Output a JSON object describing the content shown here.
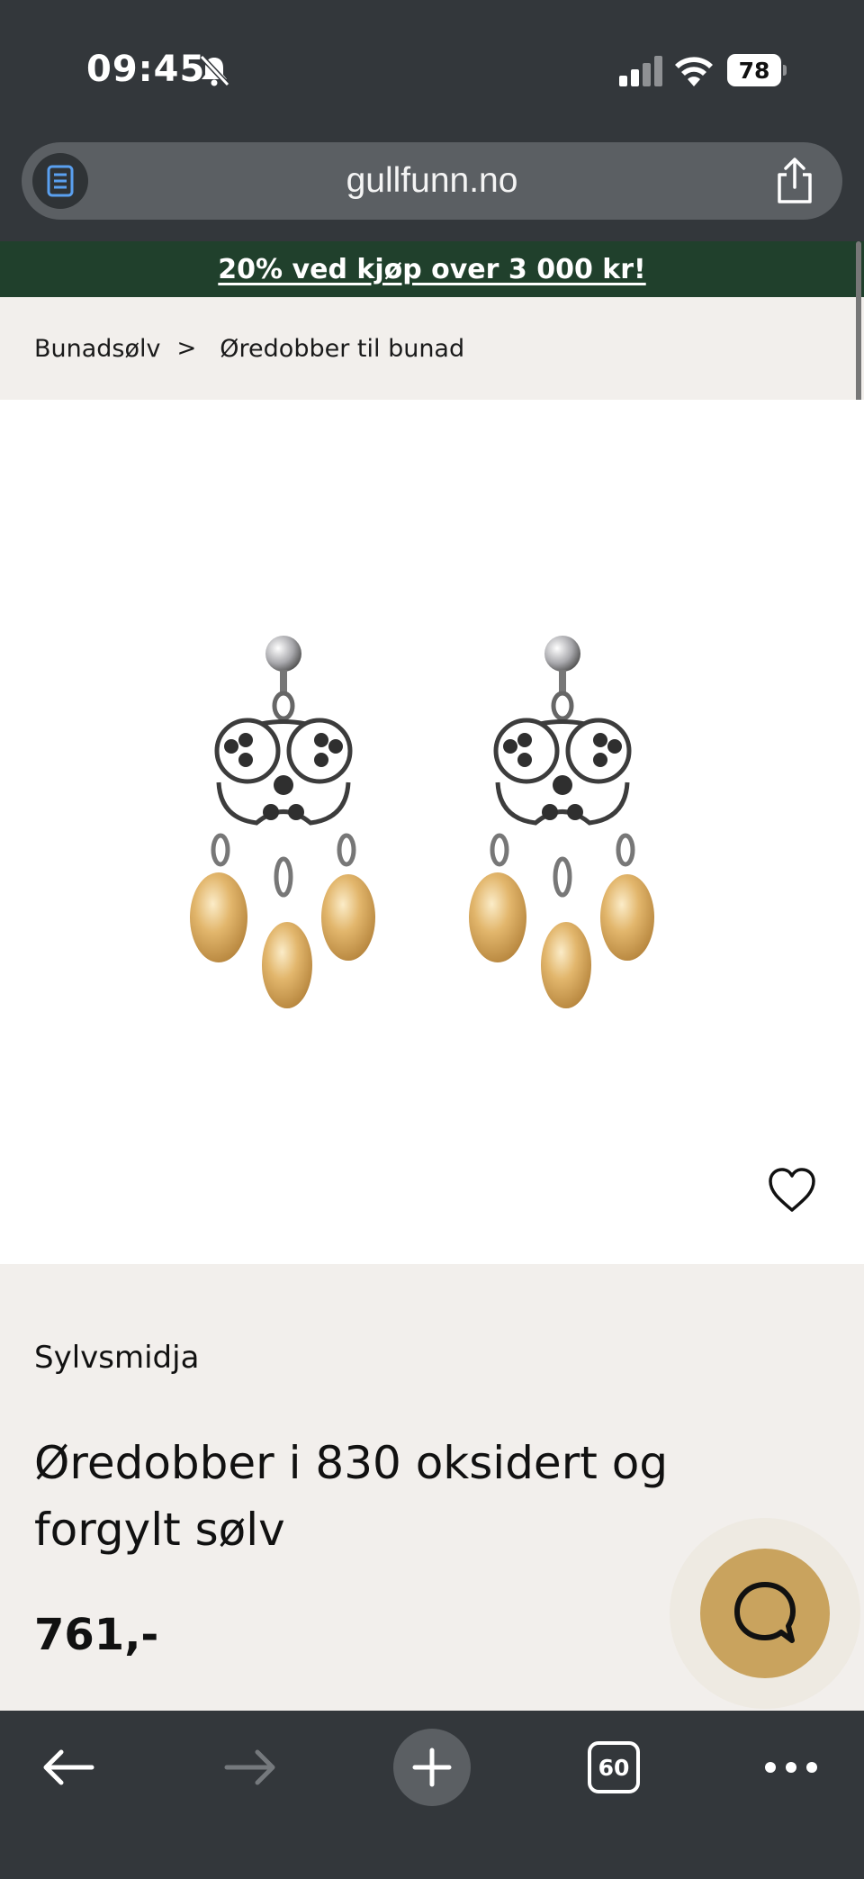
{
  "status_bar": {
    "time": "09:45",
    "battery": "78"
  },
  "browser": {
    "url": "gullfunn.no",
    "tab_count": "60"
  },
  "promo": {
    "text": "20% ved kjøp over 3 000 kr!"
  },
  "breadcrumb": {
    "items": [
      "Bunadsølv",
      "Øredobber til bunad"
    ],
    "separator": ">"
  },
  "product": {
    "brand": "Sylvsmidja",
    "title": "Øredobber i 830 oksidert og forgylt sølv",
    "price": "761,-",
    "image": "earrings-filigree-gold-drops"
  },
  "icons": {
    "reader": "reader-icon",
    "share": "share-icon",
    "wishlist": "heart-icon",
    "chat": "chat-bubble-icon",
    "back": "arrow-left-icon",
    "forward": "arrow-right-icon",
    "new_tab": "plus-icon",
    "more": "more-icon"
  },
  "colors": {
    "chrome": "#33373b",
    "promo_bg": "#20402c",
    "page_bg": "#f2efec",
    "chat_button": "#c9a35e",
    "reader_icon": "#5aa0f0"
  }
}
